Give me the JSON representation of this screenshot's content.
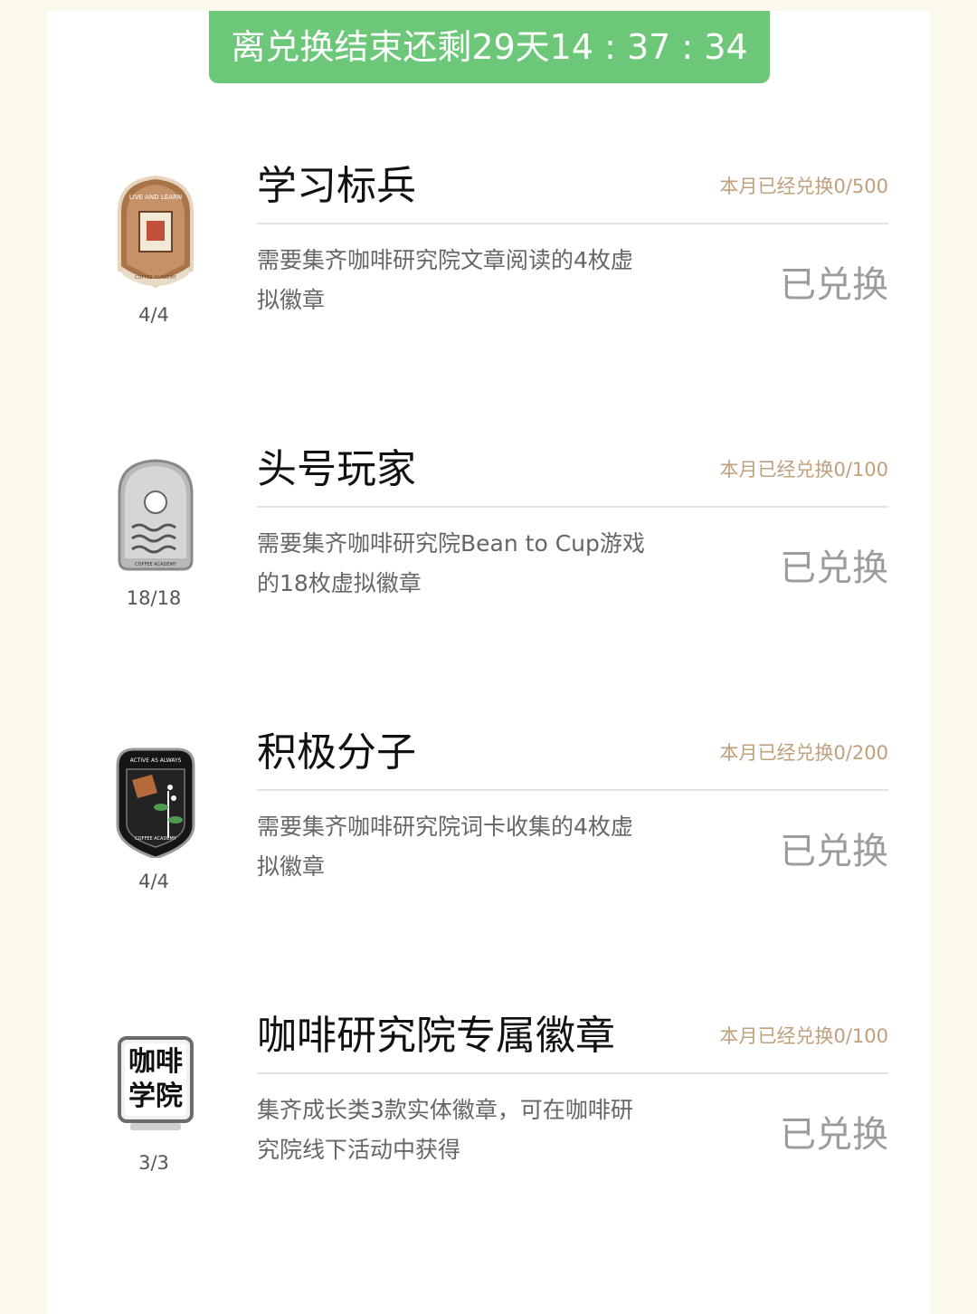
{
  "countdown": "离兑换结束还剩29天14 : 37 : 34",
  "items": [
    {
      "title": "学习标兵",
      "quota": "本月已经兑换0/500",
      "desc": "需要集齐咖啡研究院文章阅读的4枚虚拟徽章",
      "status": "已兑换",
      "progress": "4/4",
      "badge_icon": "live-and-learn-badge-icon",
      "badge_color": "#b07848",
      "badge_text": [
        "LIVE AND LEARN",
        "COFFEE ACADEMY"
      ]
    },
    {
      "title": "头号玩家",
      "quota": "本月已经兑换0/100",
      "desc": "需要集齐咖啡研究院Bean to Cup游戏的18枚虚拟徽章",
      "status": "已兑换",
      "progress": "18/18",
      "badge_icon": "coffee-academy-silver-badge-icon",
      "badge_color": "#c8c8c8",
      "badge_text": [
        "COFFEE ACADEMY"
      ]
    },
    {
      "title": "积极分子",
      "quota": "本月已经兑换0/200",
      "desc": "需要集齐咖啡研究院词卡收集的4枚虚拟徽章",
      "status": "已兑换",
      "progress": "4/4",
      "badge_icon": "active-as-always-badge-icon",
      "badge_color": "#1a1a1a",
      "badge_text": [
        "ACTIVE AS ALWAYS",
        "COFFEE ACADEMY"
      ]
    },
    {
      "title": "咖啡研究院专属徽章",
      "quota": "本月已经兑换0/100",
      "desc": "集齐成长类3款实体徽章，可在咖啡研究院线下活动中获得",
      "status": "已兑换",
      "progress": "3/3",
      "badge_icon": "coffee-academy-text-badge-icon",
      "badge_color": "#f0f0f0",
      "badge_text": [
        "咖啡",
        "学院"
      ]
    }
  ]
}
